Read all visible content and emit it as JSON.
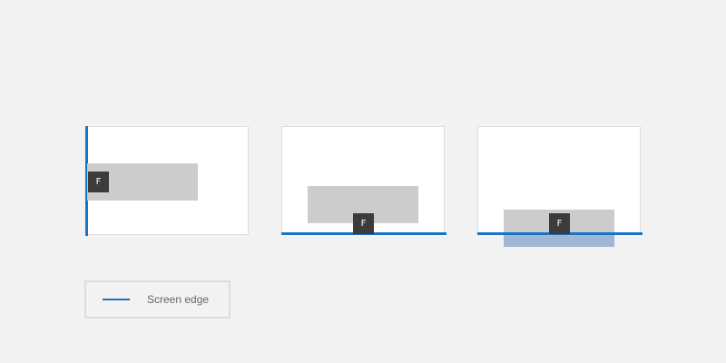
{
  "panels": [
    {
      "edge": "left",
      "focus_key": "F"
    },
    {
      "edge": "bottom",
      "focus_key": "F"
    },
    {
      "edge": "bottom",
      "focus_key": "F",
      "overflow": true
    }
  ],
  "legend": {
    "label": "Screen edge"
  },
  "colors": {
    "background": "#f2f2f2",
    "panel": "#ffffff",
    "panel_border": "#dddddd",
    "screen_edge": "#1a73c7",
    "element_box": "#cccccc",
    "overflow_box": "#9eb7d2",
    "focus_key_bg": "#3c3c3c",
    "focus_key_text": "#ffffff",
    "legend_text": "#666666"
  }
}
